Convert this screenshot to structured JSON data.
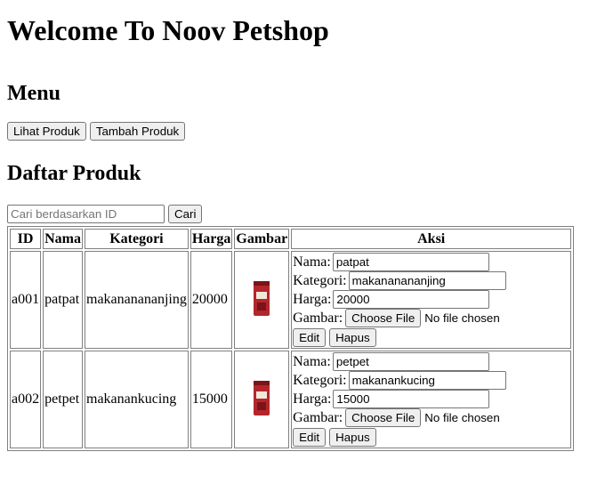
{
  "page": {
    "title": "Welcome To Noov Petshop",
    "menu_heading": "Menu",
    "list_heading": "Daftar Produk"
  },
  "menu": {
    "view_products": "Lihat Produk",
    "add_product": "Tambah Produk"
  },
  "search": {
    "placeholder": "Cari berdasarkan ID",
    "button": "Cari"
  },
  "table": {
    "headers": [
      "ID",
      "Nama",
      "Kategori",
      "Harga",
      "Gambar",
      "Aksi"
    ],
    "rows": [
      {
        "id": "a001",
        "name": "patpat",
        "category": "makananananjing",
        "price": "20000"
      },
      {
        "id": "a002",
        "name": "petpet",
        "category": "makanankucing",
        "price": "15000"
      }
    ]
  },
  "form": {
    "name_label": "Nama:",
    "category_label": "Kategori:",
    "price_label": "Harga:",
    "image_label": "Gambar:",
    "file_button": "Choose File",
    "file_status": "No file chosen",
    "edit_button": "Edit",
    "delete_button": "Hapus"
  },
  "colors": {
    "product_bag": "#b3262b",
    "product_bag_dark": "#7a1418"
  }
}
